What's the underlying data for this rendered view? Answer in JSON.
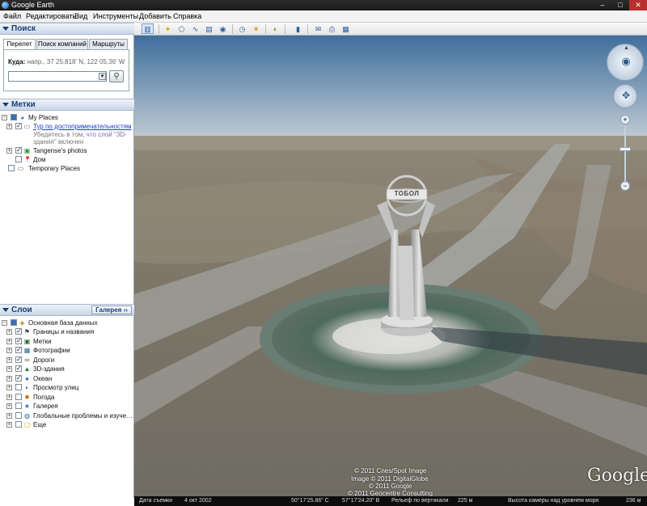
{
  "window": {
    "title": "Google Earth"
  },
  "menu": [
    "Файл",
    "Редактировать",
    "Вид",
    "Инструменты",
    "Добавить",
    "Справка"
  ],
  "search": {
    "header": "Поиск",
    "tabs": [
      "Перелет",
      "Поиск компаний",
      "Маршруты"
    ],
    "label": "Куда:",
    "hint": "напр., 37 25,818' N, 122 05,36' W",
    "value": ""
  },
  "places": {
    "header": "Метки",
    "items": {
      "my_places": "My Places",
      "tour": "Тур по достопримечательностям",
      "tour_note_1": "Убедитесь в том, что слой \"3D-",
      "tour_note_2": "здания\" включен",
      "photos": "Tangense's photos",
      "home": "Дом",
      "temporary": "Temporary Places"
    }
  },
  "layers": {
    "header": "Слои",
    "gallery_button": "Галерея",
    "root": "Основная база данных",
    "items": [
      {
        "label": "Границы и названия",
        "checked": true
      },
      {
        "label": "Метки",
        "checked": true
      },
      {
        "label": "Фотографии",
        "checked": true
      },
      {
        "label": "Дороги",
        "checked": true
      },
      {
        "label": "3D-здания",
        "checked": true
      },
      {
        "label": "Океан",
        "checked": true
      },
      {
        "label": "Просмотр улиц",
        "checked": false
      },
      {
        "label": "Погода",
        "checked": false
      },
      {
        "label": "Галерея",
        "checked": false
      },
      {
        "label": "Глобальные проблемы и изуче…",
        "checked": false
      },
      {
        "label": "Еще",
        "checked": false
      }
    ]
  },
  "map": {
    "monument_sign": "ТОБОЛ",
    "copyrights": [
      "© 2011 Cnes/Spot Image",
      "Image © 2011 DigitalGlobe",
      "© 2011 Google",
      "© 2011 Geocentre Consulting"
    ],
    "logo": "Google"
  },
  "status": {
    "date_label": "Дата съемки",
    "date_value": "4 окт 2002",
    "lat": "50°17'25.86\" С",
    "lon": "57°17'24.20\" В",
    "relief": "Рельеф по вертикали",
    "elev": "225 м",
    "eye_label": "Высота камеры над уровнем моря",
    "eye": "236 м"
  },
  "colors": {
    "link": "#1a3ccc",
    "header_text": "#1a3c73",
    "sky": "#7d97b3"
  }
}
